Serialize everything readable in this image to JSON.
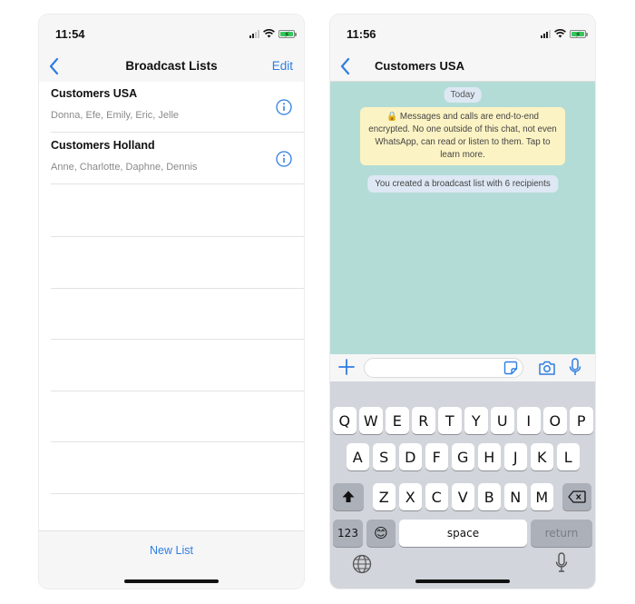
{
  "left_phone": {
    "status_time": "11:54",
    "nav": {
      "back_label": "",
      "title": "Broadcast Lists",
      "edit_label": "Edit"
    },
    "lists": [
      {
        "title": "Customers USA",
        "members": "Donna, Efe, Emily, Eric, Jelle"
      },
      {
        "title": "Customers Holland",
        "members": "Anne, Charlotte, Daphne, Dennis"
      }
    ],
    "bottom": {
      "new_list_label": "New List"
    }
  },
  "right_phone": {
    "status_time": "11:56",
    "nav": {
      "title": "Customers USA"
    },
    "chat": {
      "date_label": "Today",
      "encryption_notice": "🔒 Messages and calls are end-to-end encrypted. No one outside of this chat, not even WhatsApp, can read or listen to them. Tap to learn more.",
      "system_message": "You created a broadcast list with 6 recipients"
    },
    "input": {
      "placeholder": ""
    },
    "keyboard": {
      "row1": [
        "Q",
        "W",
        "E",
        "R",
        "T",
        "Y",
        "U",
        "I",
        "O",
        "P"
      ],
      "row2": [
        "A",
        "S",
        "D",
        "F",
        "G",
        "H",
        "J",
        "K",
        "L"
      ],
      "row3": [
        "Z",
        "X",
        "C",
        "V",
        "B",
        "N",
        "M"
      ],
      "numbers_key": "123",
      "emoji_key": "😊",
      "space_key": "space",
      "return_key": "return"
    }
  },
  "colors": {
    "accent_blue": "#2f7de1",
    "chat_background": "#b4dcd6",
    "encryption_bubble": "#fcf3c4",
    "system_pill": "#dde8f4",
    "keyboard_bg": "#d2d5db",
    "battery_green": "#34c759"
  },
  "icons": [
    "chevron-left-icon",
    "info-icon",
    "plus-icon",
    "sticker-icon",
    "camera-icon",
    "microphone-icon",
    "shift-icon",
    "backspace-icon",
    "globe-icon",
    "wifi-icon",
    "signal-icon",
    "battery-icon",
    "lock-icon"
  ]
}
